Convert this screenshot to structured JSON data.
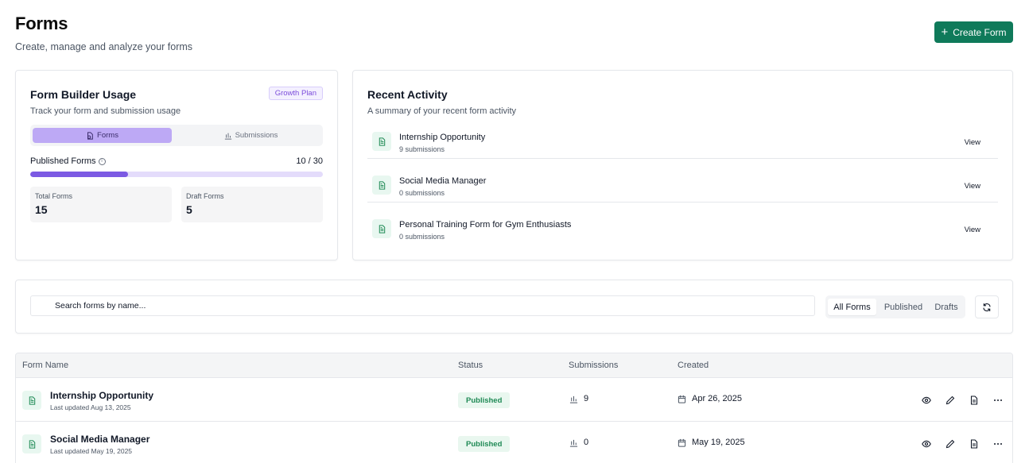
{
  "page": {
    "title": "Forms",
    "subtitle": "Create, manage and analyze your forms",
    "create_button": "Create Form"
  },
  "usage": {
    "title": "Form Builder Usage",
    "description": "Track your form and submission usage",
    "plan_badge": "Growth Plan",
    "tabs": [
      {
        "label": "Forms",
        "active": true
      },
      {
        "label": "Submissions",
        "active": false
      }
    ],
    "published_label": "Published Forms",
    "published_count": "10 / 30",
    "published_fraction": 0.333,
    "total_forms_label": "Total Forms",
    "total_forms_value": "15",
    "draft_forms_label": "Draft Forms",
    "draft_forms_value": "5"
  },
  "activity": {
    "title": "Recent Activity",
    "description": "A summary of your recent form activity",
    "items": [
      {
        "name": "Internship Opportunity",
        "sub": "9 submissions",
        "action": "View"
      },
      {
        "name": "Social Media Manager",
        "sub": "0 submissions",
        "action": "View"
      },
      {
        "name": "Personal Training Form for Gym Enthusiasts",
        "sub": "0 submissions",
        "action": "View"
      }
    ]
  },
  "search": {
    "placeholder": "Search forms by name...",
    "filters": [
      "All Forms",
      "Published",
      "Drafts"
    ],
    "active_filter": "All Forms"
  },
  "table": {
    "headers": [
      "Form Name",
      "Status",
      "Submissions",
      "Created"
    ],
    "rows": [
      {
        "name": "Internship Opportunity",
        "updated": "Last updated Aug 13, 2025",
        "status": "Published",
        "submissions": "9",
        "created": "Apr 26, 2025"
      },
      {
        "name": "Social Media Manager",
        "updated": "Last updated May 19, 2025",
        "status": "Published",
        "submissions": "0",
        "created": "May 19, 2025"
      }
    ]
  },
  "colors": {
    "primary": "#0f7a5a",
    "accent_purple": "#7c5ae3",
    "status_green": "#1f8a55"
  }
}
